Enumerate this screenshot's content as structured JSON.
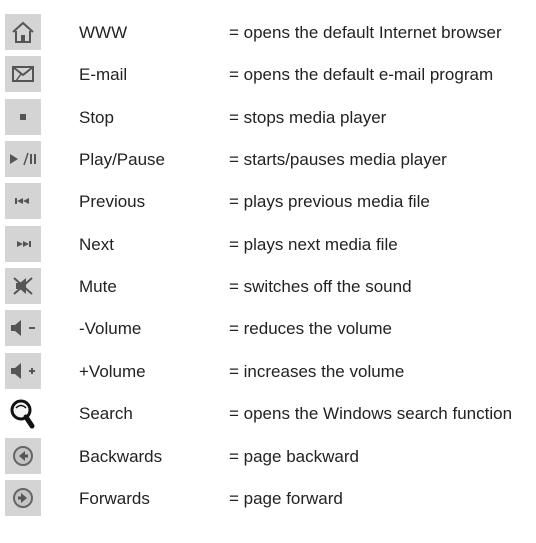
{
  "entries": [
    {
      "icon": "home-icon",
      "name": "WWW",
      "description": "= opens the default Internet browser"
    },
    {
      "icon": "email-icon",
      "name": "E-mail",
      "description": "= opens the default e-mail program"
    },
    {
      "icon": "stop-icon",
      "name": "Stop",
      "description": "= stops media player"
    },
    {
      "icon": "play-pause-icon",
      "name": "Play/Pause",
      "description": "= starts/pauses media player"
    },
    {
      "icon": "previous-track-icon",
      "name": "Previous",
      "description": "= plays previous media file"
    },
    {
      "icon": "next-track-icon",
      "name": "Next",
      "description": "= plays next media file"
    },
    {
      "icon": "mute-icon",
      "name": "Mute",
      "description": "= switches off the sound"
    },
    {
      "icon": "volume-down-icon",
      "name": "-Volume",
      "description": "= reduces the volume"
    },
    {
      "icon": "volume-up-icon",
      "name": "+Volume",
      "description": "= increases the volume"
    },
    {
      "icon": "search-icon",
      "name": "Search",
      "description": "= opens the Windows search function"
    },
    {
      "icon": "back-arrow-icon",
      "name": "Backwards",
      "description": "= page backward"
    },
    {
      "icon": "forward-arrow-icon",
      "name": "Forwards",
      "description": "= page forward"
    }
  ]
}
